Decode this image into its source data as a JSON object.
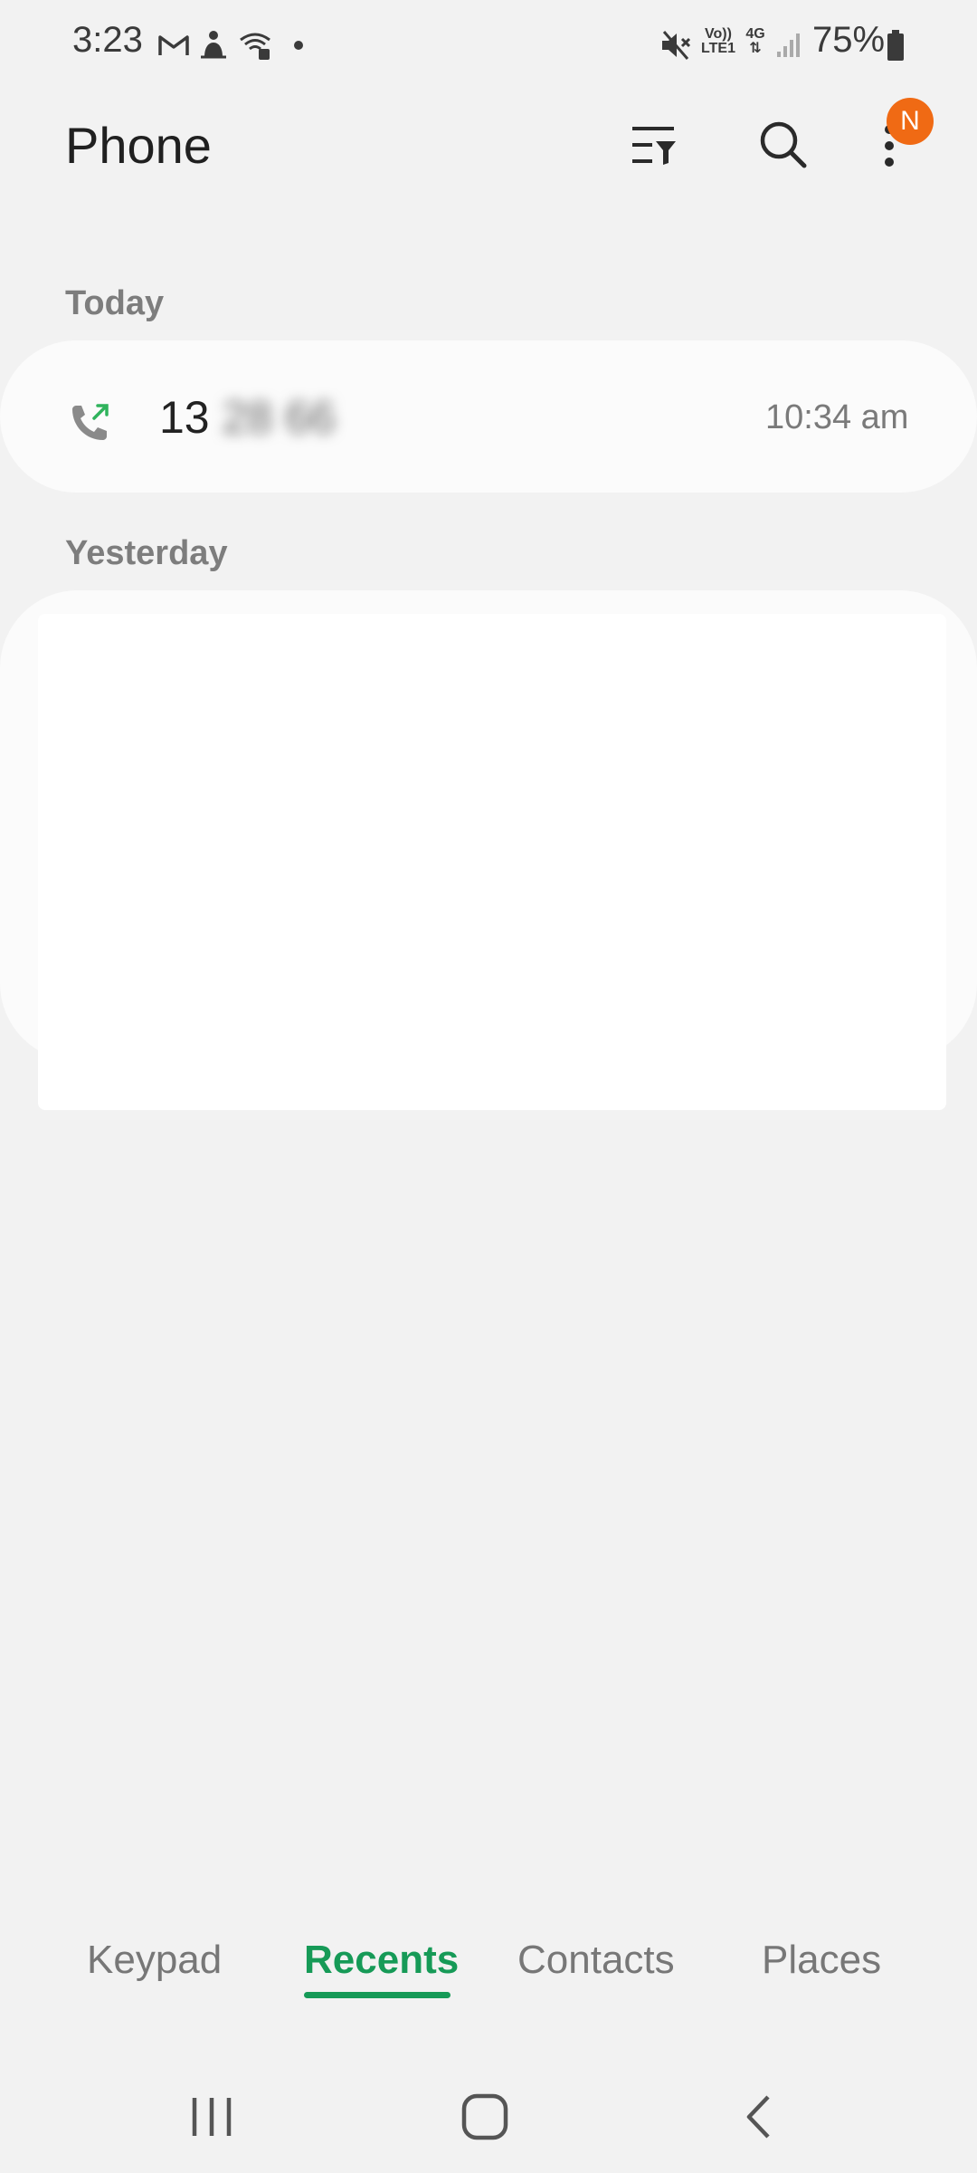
{
  "status_bar": {
    "time": "3:23",
    "network_top": "Vo))",
    "network_bottom": "LTE1",
    "data_type": "4G",
    "battery": "75%"
  },
  "header": {
    "title": "Phone",
    "badge": "N"
  },
  "sections": {
    "today": {
      "label": "Today",
      "calls": [
        {
          "number_prefix": "13",
          "number_hidden": "28 66",
          "time": "10:34 am",
          "icon": "outgoing-call-icon"
        }
      ]
    },
    "yesterday": {
      "label": "Yesterday"
    }
  },
  "tabs": [
    {
      "label": "Keypad"
    },
    {
      "label": "Recents"
    },
    {
      "label": "Contacts"
    },
    {
      "label": "Places"
    }
  ],
  "colors": {
    "accent": "#169a57",
    "badge": "#f06a14",
    "background": "#f2f2f2"
  },
  "nav_icons": [
    "recent-apps-icon",
    "home-icon",
    "back-icon"
  ]
}
